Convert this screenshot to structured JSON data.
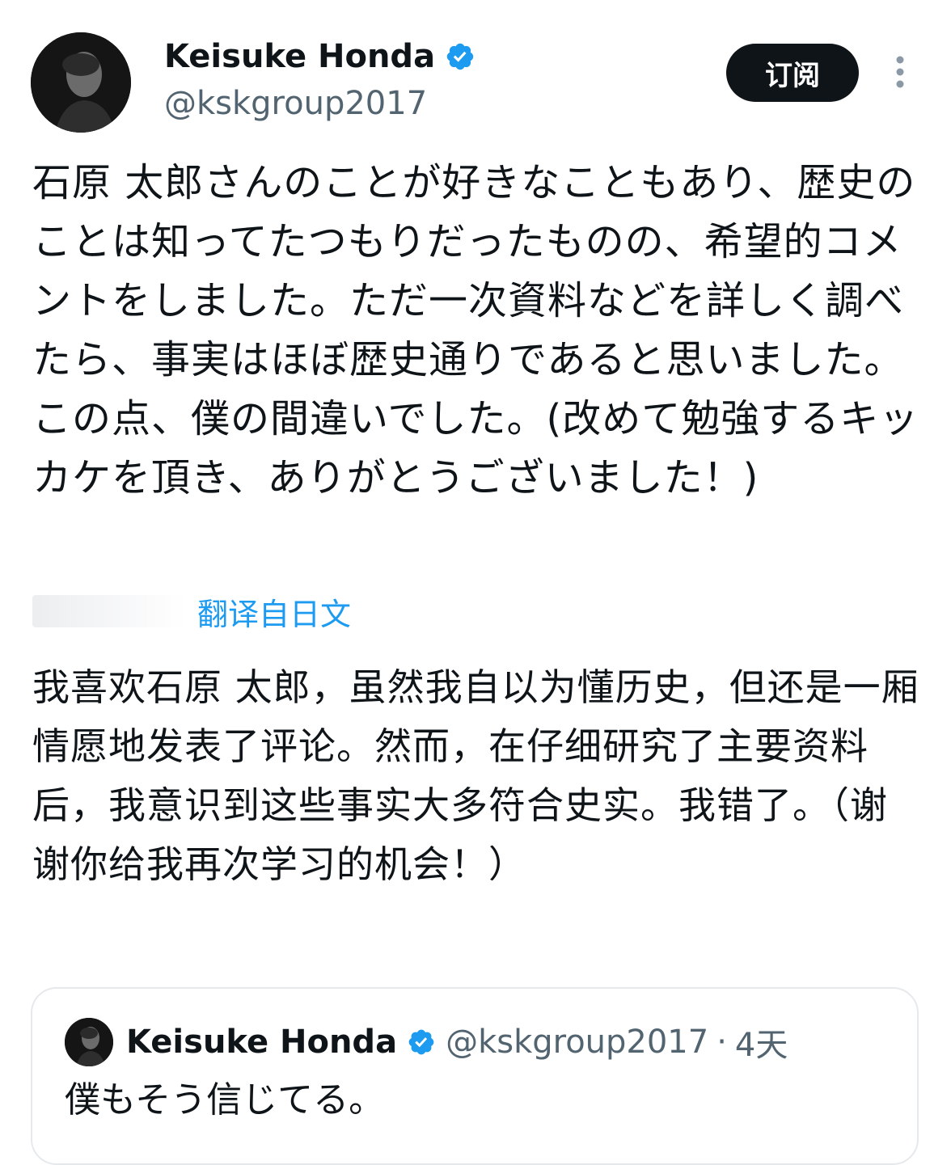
{
  "author": {
    "display_name": "Keisuke Honda",
    "handle": "@kskgroup2017"
  },
  "actions": {
    "subscribe_label": "订阅"
  },
  "icons": {
    "verified": "verified-badge-icon",
    "more": "more-vertical-icon",
    "avatar": "profile-photo"
  },
  "colors": {
    "verified_blue": "#1d9bf0",
    "button_dark": "#0f1419",
    "secondary_text": "#536471",
    "link_blue": "#1d9bf0"
  },
  "tweet": {
    "text": "石原 太郎さんのことが好きなこともあり、歴史のことは知ってたつもりだったものの、希望的コメントをしました。ただ一次資料などを詳しく調べたら、事実はほぼ歴史通りであると思いました。この点、僕の間違いでした。(改めて勉強するキッカケを頂き、ありがとうございました！)",
    "translate_label": "翻译自日文",
    "translation": "我喜欢石原 太郎，虽然我自以为懂历史，但还是一厢情愿地发表了评论。然而，在仔细研究了主要资料后，我意识到这些事实大多符合史实。我错了。（谢谢你给我再次学习的机会！）"
  },
  "quoted_tweet": {
    "display_name": "Keisuke Honda",
    "handle": "@kskgroup2017",
    "separator": "·",
    "time": "4天",
    "text": "僕もそう信じてる。"
  }
}
